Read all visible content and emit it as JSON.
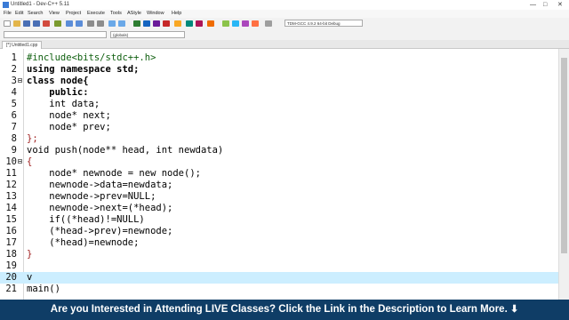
{
  "window": {
    "title": "Untitled1 - Dev-C++ 5.11",
    "controls": [
      "—",
      "□",
      "✕"
    ]
  },
  "menu": [
    "File",
    "Edit",
    "Search",
    "View",
    "Project",
    "Execute",
    "Tools",
    "AStyle",
    "Window",
    "Help"
  ],
  "toolbar": {
    "compiler": "TDM-GCC 4.9.2 64-bit Debug",
    "scope": "",
    "globals": "(globals)"
  },
  "tab": {
    "label": "[*] Untitled1.cpp"
  },
  "editor": {
    "current_line": "20",
    "lines": [
      {
        "n": "1",
        "text": "#include<bits/stdc++.h>"
      },
      {
        "n": "2",
        "text": "using namespace std;"
      },
      {
        "n": "3",
        "text": "class node{"
      },
      {
        "n": "4",
        "text": "    public:"
      },
      {
        "n": "5",
        "text": "    int data;"
      },
      {
        "n": "6",
        "text": "    node* next;"
      },
      {
        "n": "7",
        "text": "    node* prev;"
      },
      {
        "n": "8",
        "text": "};"
      },
      {
        "n": "9",
        "text": "void push(node** head, int newdata)"
      },
      {
        "n": "10",
        "text": "{"
      },
      {
        "n": "11",
        "text": "    node* newnode = new node();"
      },
      {
        "n": "12",
        "text": "    newnode->data=newdata;"
      },
      {
        "n": "13",
        "text": "    newnode->prev=NULL;"
      },
      {
        "n": "14",
        "text": "    newnode->next=(*head);"
      },
      {
        "n": "15",
        "text": "    if((*head)!=NULL)"
      },
      {
        "n": "16",
        "text": "    (*head->prev)=newnode;"
      },
      {
        "n": "17",
        "text": "    (*head)=newnode;"
      },
      {
        "n": "18",
        "text": "}"
      },
      {
        "n": "19",
        "text": ""
      },
      {
        "n": "20",
        "text": "v"
      },
      {
        "n": "21",
        "text": "main()"
      }
    ]
  },
  "banner": {
    "text": "Are you Interested in Attending LIVE Classes? Click the Link in the Description to Learn More.",
    "arrow": "⬇"
  }
}
